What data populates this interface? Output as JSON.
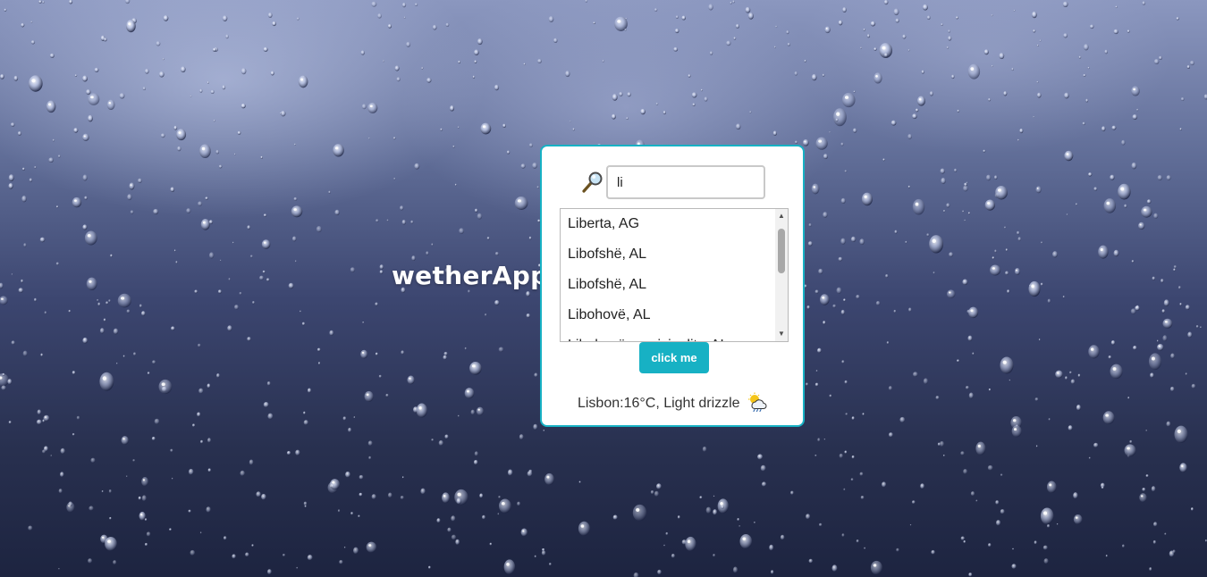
{
  "app": {
    "title": "wetherApp"
  },
  "search": {
    "icon": "magnifier-icon",
    "value": "li",
    "placeholder": ""
  },
  "suggestions": {
    "items": [
      "Liberta, AG",
      "Libofshë, AL",
      "Libofshë, AL",
      "Libohovë, AL",
      "Libohovë municipality, AL"
    ]
  },
  "actions": {
    "submit_label": "click me"
  },
  "weather": {
    "summary": "Lisbon:16°C, Light drizzle",
    "icon": "drizzle-cloud-icon"
  },
  "colors": {
    "accent": "#17b1c4",
    "card_bg": "#ffffff",
    "background_dark": "#28304f",
    "background_light": "#8b97bf"
  }
}
